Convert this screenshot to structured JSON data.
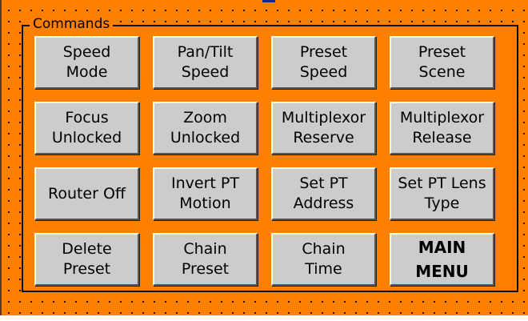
{
  "colors": {
    "panel_background": "#ff8000",
    "button_face": "#cccccc",
    "text": "#000000"
  },
  "group": {
    "title": "Commands"
  },
  "buttons": [
    {
      "lines": [
        "Speed",
        "Mode"
      ],
      "bold": false
    },
    {
      "lines": [
        "Pan/Tilt",
        "Speed"
      ],
      "bold": false
    },
    {
      "lines": [
        "Preset",
        "Speed"
      ],
      "bold": false
    },
    {
      "lines": [
        "Preset",
        "Scene"
      ],
      "bold": false
    },
    {
      "lines": [
        "Focus",
        "Unlocked"
      ],
      "bold": false
    },
    {
      "lines": [
        "Zoom",
        "Unlocked"
      ],
      "bold": false
    },
    {
      "lines": [
        "Multiplexor",
        "Reserve"
      ],
      "bold": false
    },
    {
      "lines": [
        "Multiplexor",
        "Release"
      ],
      "bold": false
    },
    {
      "lines": [
        "Router Off"
      ],
      "bold": false
    },
    {
      "lines": [
        "Invert PT",
        "Motion"
      ],
      "bold": false
    },
    {
      "lines": [
        "Set PT",
        "Address"
      ],
      "bold": false
    },
    {
      "lines": [
        "Set PT Lens",
        "Type"
      ],
      "bold": false
    },
    {
      "lines": [
        "Delete",
        "Preset"
      ],
      "bold": false
    },
    {
      "lines": [
        "Chain",
        "Preset"
      ],
      "bold": false
    },
    {
      "lines": [
        "Chain",
        "Time"
      ],
      "bold": false
    },
    {
      "lines": [
        "MAIN",
        "MENU"
      ],
      "bold": true
    }
  ]
}
